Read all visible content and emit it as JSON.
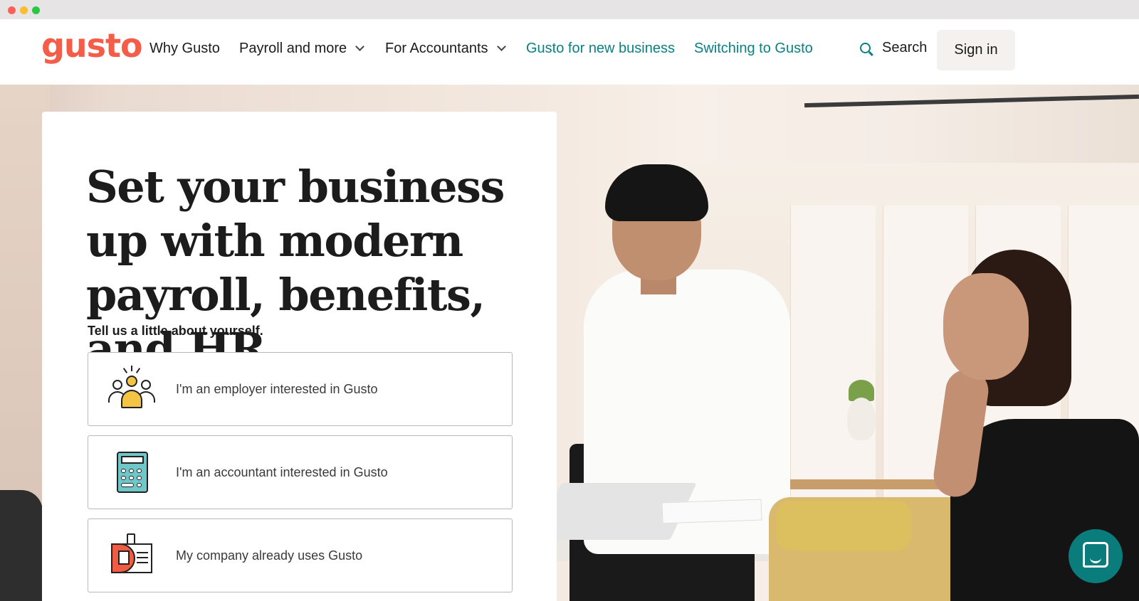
{
  "browser": {
    "traffic_lights": [
      "close",
      "minimize",
      "zoom"
    ]
  },
  "header": {
    "logo": "gusto",
    "nav": [
      {
        "label": "Why Gusto",
        "dropdown": false
      },
      {
        "label": "Payroll and more",
        "dropdown": true
      },
      {
        "label": "For Accountants",
        "dropdown": true
      },
      {
        "label": "Gusto for new business",
        "dropdown": false
      },
      {
        "label": "Switching to Gusto",
        "dropdown": false
      }
    ],
    "search_label": "Search",
    "signin_label": "Sign in"
  },
  "hero": {
    "headline": "Set your business up with modern payroll, benefits, and HR.",
    "subheading": "Tell us a little about yourself.",
    "options": [
      {
        "label": "I'm an employer interested in Gusto",
        "icon": "people-group-icon"
      },
      {
        "label": "I'm an accountant interested in Gusto",
        "icon": "calculator-icon"
      },
      {
        "label": "My company already uses Gusto",
        "icon": "id-badge-icon"
      }
    ]
  },
  "chat": {
    "icon": "chat-icon"
  },
  "colors": {
    "brand": "#f45d48",
    "teal": "#0a8080",
    "signin_bg": "#f4f1ee",
    "chat_bg": "#0a7c7c"
  }
}
